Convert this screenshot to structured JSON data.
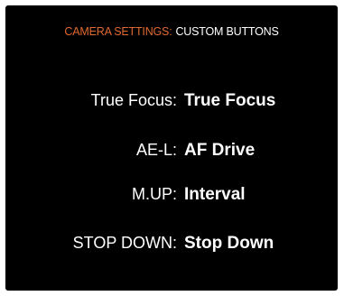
{
  "header": {
    "section": "CAMERA SETTINGS:",
    "page": "CUSTOM BUTTONS"
  },
  "buttons": [
    {
      "label": "True Focus:",
      "value": "True Focus"
    },
    {
      "label": "AE-L:",
      "value": "AF Drive"
    },
    {
      "label": "M.UP:",
      "value": "Interval"
    },
    {
      "label": "STOP DOWN:",
      "value": "Stop Down"
    }
  ],
  "colors": {
    "accent": "#e0692f",
    "background": "#000000",
    "text": "#ffffff"
  }
}
